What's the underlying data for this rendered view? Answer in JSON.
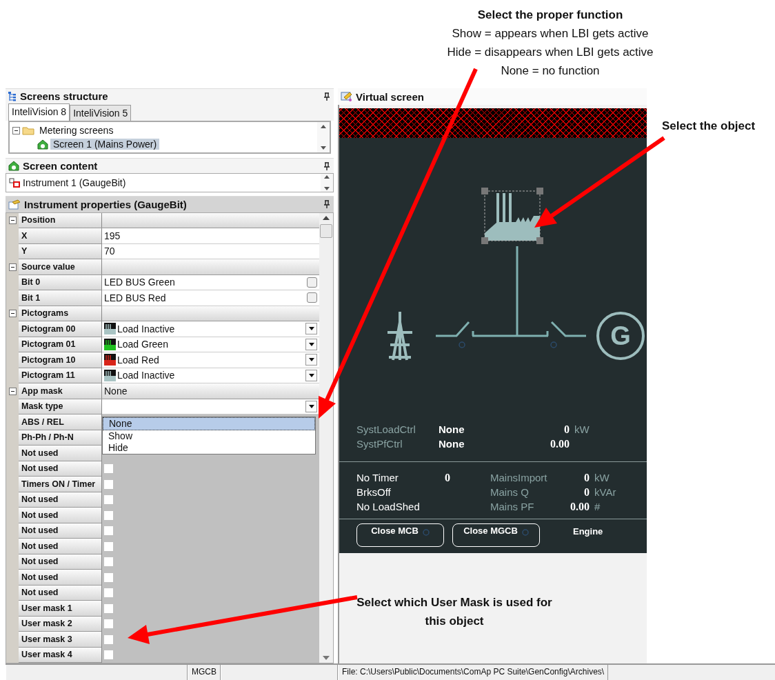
{
  "annotations": {
    "function_hint": {
      "title": "Select the proper function",
      "lines": [
        "Show = appears when LBI gets active",
        "Hide = disappears when LBI gets active",
        "None = no function"
      ]
    },
    "object_hint": "Select the object",
    "mask_hint": "Select which User Mask is used for this object"
  },
  "screens_structure": {
    "title": "Screens structure",
    "tabs": [
      {
        "label": "InteliVision 8",
        "selected": true
      },
      {
        "label": "InteliVision 5",
        "selected": false
      }
    ],
    "tree": [
      {
        "label": "Metering screens",
        "expanded": true,
        "selected": false,
        "children": [
          {
            "label": "Screen 1 (Mains Power)",
            "selected": true
          }
        ]
      }
    ]
  },
  "screen_content": {
    "title": "Screen content",
    "items": [
      {
        "label": "Instrument 1 (GaugeBit)"
      }
    ]
  },
  "instrument_properties": {
    "title": "Instrument properties (GaugeBit)",
    "rows": [
      {
        "kind": "category",
        "label": "Position",
        "expanded": true
      },
      {
        "kind": "text",
        "label": "X",
        "value": "195"
      },
      {
        "kind": "text",
        "label": "Y",
        "value": "70"
      },
      {
        "kind": "category",
        "label": "Source value",
        "expanded": true
      },
      {
        "kind": "check",
        "label": "Bit 0",
        "value": "LED BUS Green",
        "checked": false
      },
      {
        "kind": "check",
        "label": "Bit 1",
        "value": "LED BUS Red",
        "checked": false
      },
      {
        "kind": "category",
        "label": "Pictograms",
        "expanded": true
      },
      {
        "kind": "pictogram",
        "label": "Pictogram 00",
        "value": "Load Inactive",
        "color": "#a9c4c4"
      },
      {
        "kind": "pictogram",
        "label": "Pictogram 01",
        "value": "Load Green",
        "color": "#1fbf1f"
      },
      {
        "kind": "pictogram",
        "label": "Pictogram 10",
        "value": "Load Red",
        "color": "#d8251a"
      },
      {
        "kind": "pictogram",
        "label": "Pictogram 11",
        "value": "Load Inactive",
        "color": "#a9c4c4"
      },
      {
        "kind": "category",
        "label": "App mask",
        "value": "None",
        "expanded": true
      },
      {
        "kind": "combo",
        "label": "Mask type",
        "expanded": true,
        "options": [
          {
            "label": "None",
            "selected": true
          },
          {
            "label": "Show",
            "selected": false
          },
          {
            "label": "Hide",
            "selected": false
          }
        ]
      },
      {
        "kind": "flag",
        "label": "ABS / REL"
      },
      {
        "kind": "flag",
        "label": "Ph-Ph / Ph-N"
      },
      {
        "kind": "flag",
        "label": "Not used"
      },
      {
        "kind": "flag",
        "label": "Not used",
        "checked": false
      },
      {
        "kind": "flag",
        "label": "Timers ON / Timer",
        "checked": false
      },
      {
        "kind": "flag",
        "label": "Not used",
        "checked": false
      },
      {
        "kind": "flag",
        "label": "Not used",
        "checked": false
      },
      {
        "kind": "flag",
        "label": "Not used",
        "checked": false
      },
      {
        "kind": "flag",
        "label": "Not used",
        "checked": false
      },
      {
        "kind": "flag",
        "label": "Not used",
        "checked": false
      },
      {
        "kind": "flag",
        "label": "Not used",
        "checked": false
      },
      {
        "kind": "flag",
        "label": "Not used",
        "checked": false
      },
      {
        "kind": "flag",
        "label": "User mask 1",
        "checked": false
      },
      {
        "kind": "flag",
        "label": "User mask 2",
        "checked": false
      },
      {
        "kind": "flag",
        "label": "User mask 3",
        "checked": false
      },
      {
        "kind": "flag",
        "label": "User mask 4",
        "checked": false
      }
    ]
  },
  "virtual_screen": {
    "title": "Virtual screen",
    "generator_symbol": "G",
    "control_rows": [
      {
        "label": "SystLoadCtrl",
        "mode": "None",
        "value": "0",
        "unit": "kW"
      },
      {
        "label": "SystPfCtrl",
        "mode": "None",
        "value": "0.00"
      }
    ],
    "status_rows": [
      {
        "status": "No Timer",
        "timer": "0",
        "label": "MainsImport",
        "value": "0",
        "unit": "kW"
      },
      {
        "status": "BrksOff",
        "label": "Mains Q",
        "value": "0",
        "unit": "kVAr"
      },
      {
        "status": "No LoadShed",
        "label": "Mains PF",
        "value": "0.00",
        "unit": "#"
      }
    ],
    "buttons": [
      {
        "label": "Close MCB",
        "indicator_on": false
      },
      {
        "label": "Close MGCB",
        "indicator_on": false
      }
    ],
    "footer_label": "Engine"
  },
  "status_bar": {
    "cells": [
      "MGCB",
      "File: C:\\Users\\Public\\Documents\\ComAp PC Suite\\GenConfig\\Archives\\"
    ]
  }
}
